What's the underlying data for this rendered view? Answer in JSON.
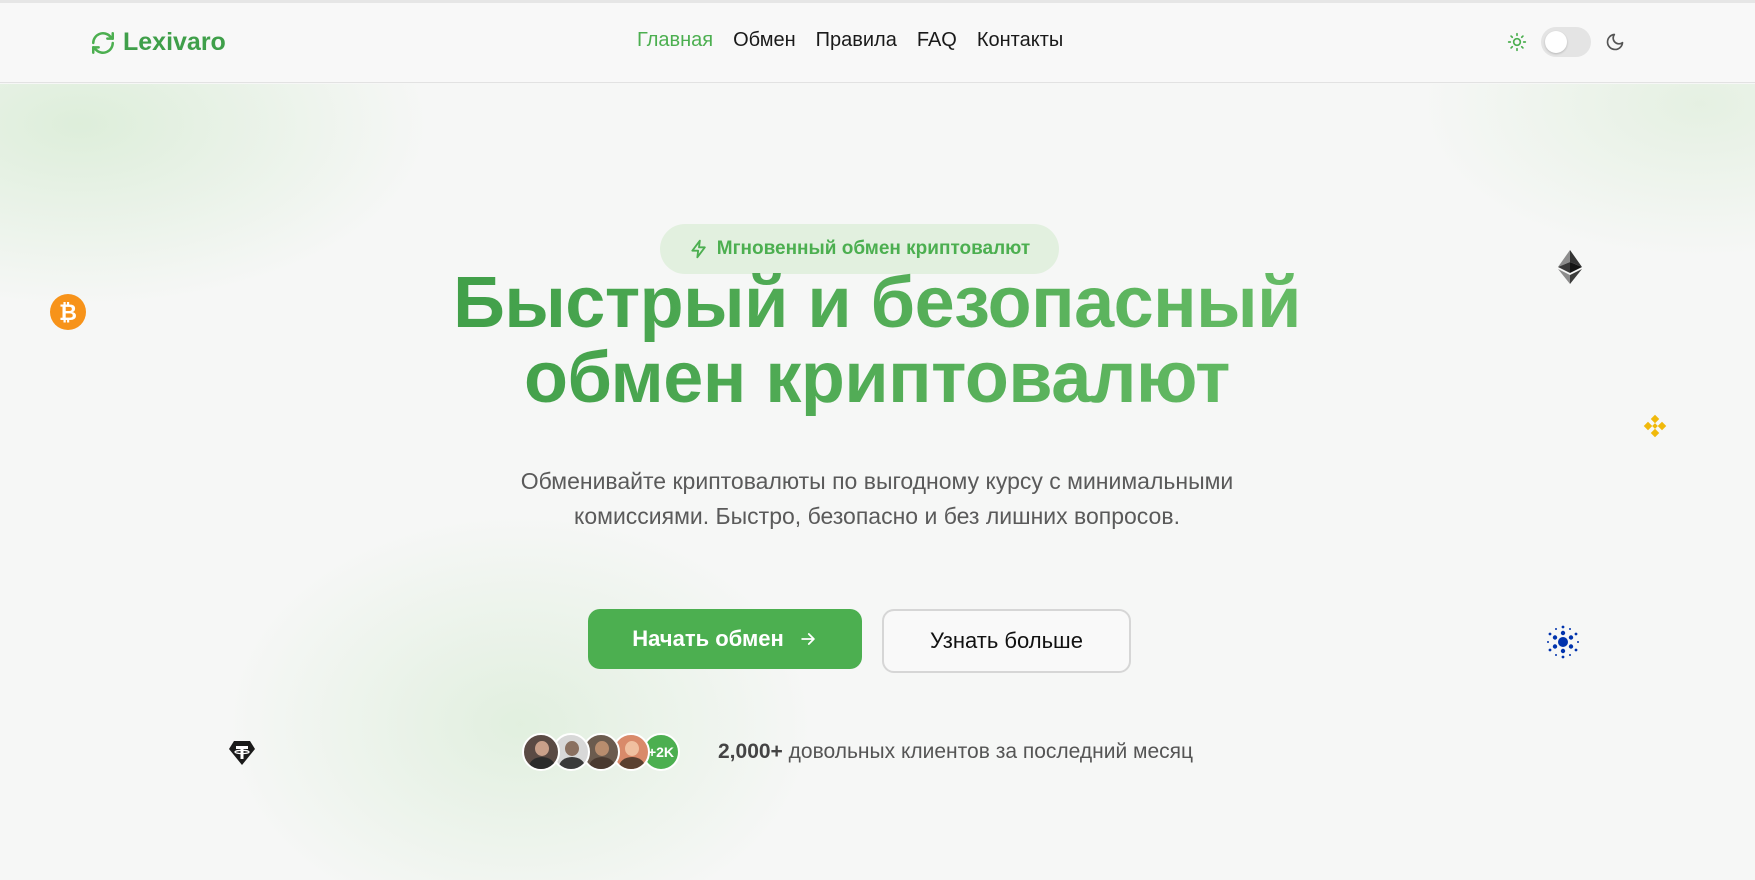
{
  "header": {
    "brand": "Lexivaro",
    "nav": [
      {
        "label": "Главная",
        "active": true
      },
      {
        "label": "Обмен",
        "active": false
      },
      {
        "label": "Правила",
        "active": false
      },
      {
        "label": "FAQ",
        "active": false
      },
      {
        "label": "Контакты",
        "active": false
      }
    ],
    "theme_toggle": {
      "light_icon": "sun-icon",
      "dark_icon": "moon-icon",
      "enabled": false
    }
  },
  "hero": {
    "badge": "Мгновенный обмен криптовалют",
    "title_line1": "Быстрый и безопасный",
    "title_line2": "обмен криптовалют",
    "subtitle": "Обменивайте криптовалюты по выгодному курсу с минимальными комиссиями. Быстро, безопасно и без лишних вопросов.",
    "primary_button": "Начать обмен",
    "secondary_button": "Узнать больше",
    "social_proof": {
      "extra_count": "+2K",
      "count": "2,000+",
      "text": "довольных клиентов за последний месяц"
    }
  },
  "floating_coins": [
    "bitcoin-icon",
    "ethereum-icon",
    "binance-icon",
    "cardano-icon",
    "tether-icon"
  ],
  "colors": {
    "accent": "#4caf50",
    "accent_dark": "#3a9a44",
    "badge_bg": "#e2f0df",
    "bitcoin": "#f7931a",
    "binance": "#f0b90b",
    "cardano": "#0033ad"
  }
}
